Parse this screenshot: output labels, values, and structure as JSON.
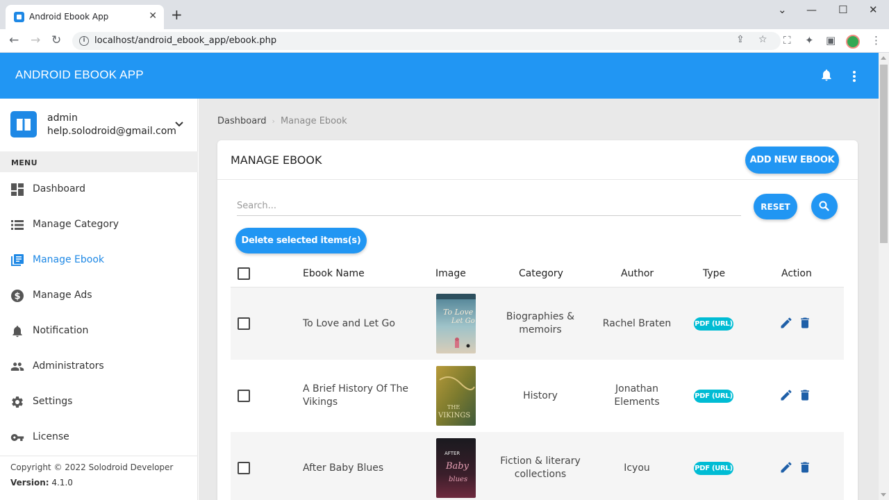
{
  "browser": {
    "tab_title": "Android Ebook App",
    "url": "localhost/android_ebook_app/ebook.php"
  },
  "app": {
    "title": "ANDROID EBOOK APP",
    "accent_color": "#2196f3",
    "badge_color": "#00bcd4"
  },
  "user": {
    "name": "admin",
    "email": "help.solodroid@gmail.com"
  },
  "sidebar": {
    "menu_header": "MENU",
    "items": [
      {
        "label": "Dashboard",
        "icon": "dashboard-icon"
      },
      {
        "label": "Manage Category",
        "icon": "list-icon"
      },
      {
        "label": "Manage Ebook",
        "icon": "book-list-icon",
        "active": true
      },
      {
        "label": "Manage Ads",
        "icon": "dollar-icon"
      },
      {
        "label": "Notification",
        "icon": "bell-icon"
      },
      {
        "label": "Administrators",
        "icon": "people-icon"
      },
      {
        "label": "Settings",
        "icon": "gear-icon"
      },
      {
        "label": "License",
        "icon": "key-icon"
      }
    ],
    "copyright": "Copyright © 2022 Solodroid Developer",
    "version_label": "Version:",
    "version_value": "4.1.0"
  },
  "breadcrumb": {
    "home": "Dashboard",
    "current": "Manage Ebook"
  },
  "card": {
    "title": "MANAGE EBOOK",
    "add_button": "ADD NEW EBOOK",
    "search_placeholder": "Search...",
    "reset_button": "RESET",
    "delete_selected": "Delete selected items(s)"
  },
  "table": {
    "headers": [
      "Ebook Name",
      "Image",
      "Category",
      "Author",
      "Type",
      "Action"
    ],
    "rows": [
      {
        "name_line1": "To Love and Let Go",
        "name_line2": "",
        "category_line1": "Biographies &",
        "category_line2": "memoirs",
        "author_line1": "Rachel Braten",
        "author_line2": "",
        "type": "PDF (URL)"
      },
      {
        "name_line1": "A Brief History Of The",
        "name_line2": "Vikings",
        "category_line1": "History",
        "category_line2": "",
        "author_line1": "Jonathan",
        "author_line2": "Elements",
        "type": "PDF (URL)"
      },
      {
        "name_line1": "After Baby Blues",
        "name_line2": "",
        "category_line1": "Fiction & literary",
        "category_line2": "collections",
        "author_line1": "Icyou",
        "author_line2": "",
        "type": "PDF (URL)"
      }
    ]
  }
}
